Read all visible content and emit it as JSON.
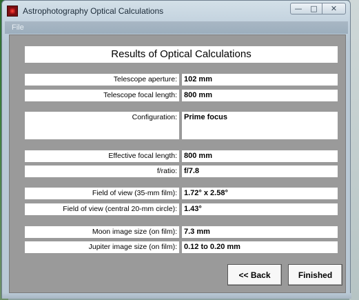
{
  "window": {
    "title": "Astrophotography Optical Calculations",
    "minimize_symbol": "—",
    "maximize_symbol": "□",
    "close_symbol": "✕"
  },
  "menu": {
    "file_label": "File"
  },
  "results": {
    "heading": "Results of Optical Calculations",
    "rows": [
      {
        "label": "Telescope aperture:",
        "value": "102 mm"
      },
      {
        "label": "Telescope focal length:",
        "value": "800 mm"
      },
      {
        "label": "Configuration:",
        "value": "Prime focus"
      },
      {
        "label": "Effective focal length:",
        "value": "800 mm"
      },
      {
        "label": "f/ratio:",
        "value": "f/7.8"
      },
      {
        "label": "Field of view (35-mm film):",
        "value": "1.72° x 2.58°"
      },
      {
        "label": "Field of view (central 20-mm circle):",
        "value": "1.43°"
      },
      {
        "label": "Moon image size (on film):",
        "value": "7.3 mm"
      },
      {
        "label": "Jupiter image size (on film):",
        "value": "0.12 to 0.20 mm"
      }
    ]
  },
  "buttons": {
    "back_label": "<< Back",
    "finished_label": "Finished"
  }
}
